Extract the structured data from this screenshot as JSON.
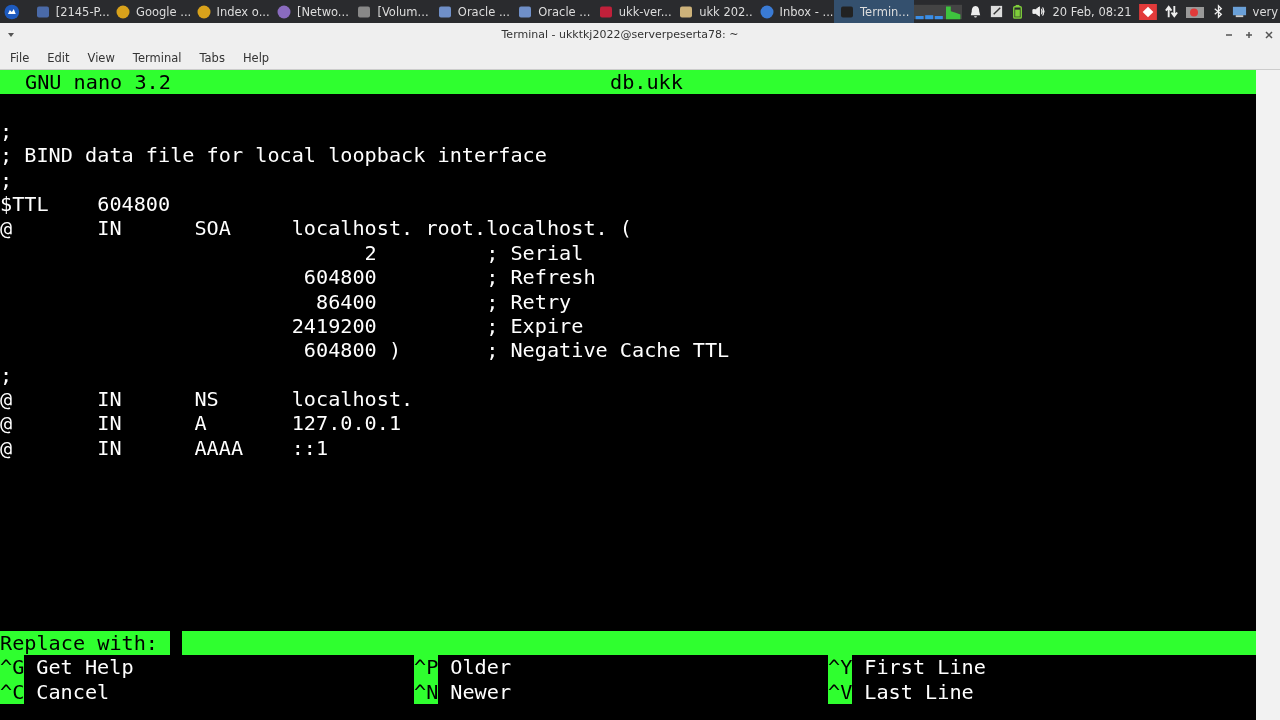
{
  "taskbar": {
    "items": [
      {
        "kind": "app",
        "label": "[2145-P...",
        "selected": false
      },
      {
        "kind": "browser",
        "label": "Google ...",
        "selected": false
      },
      {
        "kind": "browser",
        "label": "Index o...",
        "selected": false
      },
      {
        "kind": "globe",
        "label": "[Netwo...",
        "selected": false
      },
      {
        "kind": "audio",
        "label": "[Volum...",
        "selected": false
      },
      {
        "kind": "vm",
        "label": "Oracle ...",
        "selected": false
      },
      {
        "kind": "vm",
        "label": "Oracle ...",
        "selected": false
      },
      {
        "kind": "pdf",
        "label": "ukk-ver...",
        "selected": false
      },
      {
        "kind": "folder",
        "label": "ukk 202...",
        "selected": false
      },
      {
        "kind": "mail",
        "label": "Inbox - ...",
        "selected": false
      },
      {
        "kind": "terminal",
        "label": "Termin...",
        "selected": true
      }
    ],
    "clock": "20 Feb, 08:21",
    "user": "very"
  },
  "window": {
    "title": "Terminal - ukktkj2022@serverpeserta78: ~"
  },
  "menu": [
    "File",
    "Edit",
    "View",
    "Terminal",
    "Tabs",
    "Help"
  ],
  "nano": {
    "version": "GNU nano 3.2",
    "filename": "db.ukk",
    "lines": [
      ";",
      "; BIND data file for local loopback interface",
      ";",
      "$TTL    604800",
      "@       IN      SOA     localhost. root.localhost. (",
      "                              2         ; Serial",
      "                         604800         ; Refresh",
      "                          86400         ; Retry",
      "                        2419200         ; Expire",
      "                         604800 )       ; Negative Cache TTL",
      ";",
      "@       IN      NS      localhost.",
      "@       IN      A       127.0.0.1",
      "@       IN      AAAA    ::1"
    ],
    "prompt": "Replace with:",
    "shortcuts": [
      [
        {
          "key": "^G",
          "label": "Get Help"
        },
        {
          "key": "^C",
          "label": "Cancel"
        }
      ],
      [
        {
          "key": "^P",
          "label": "Older"
        },
        {
          "key": "^N",
          "label": "Newer"
        }
      ],
      [
        {
          "key": "^Y",
          "label": "First Line"
        },
        {
          "key": "^V",
          "label": "Last Line"
        }
      ]
    ]
  }
}
